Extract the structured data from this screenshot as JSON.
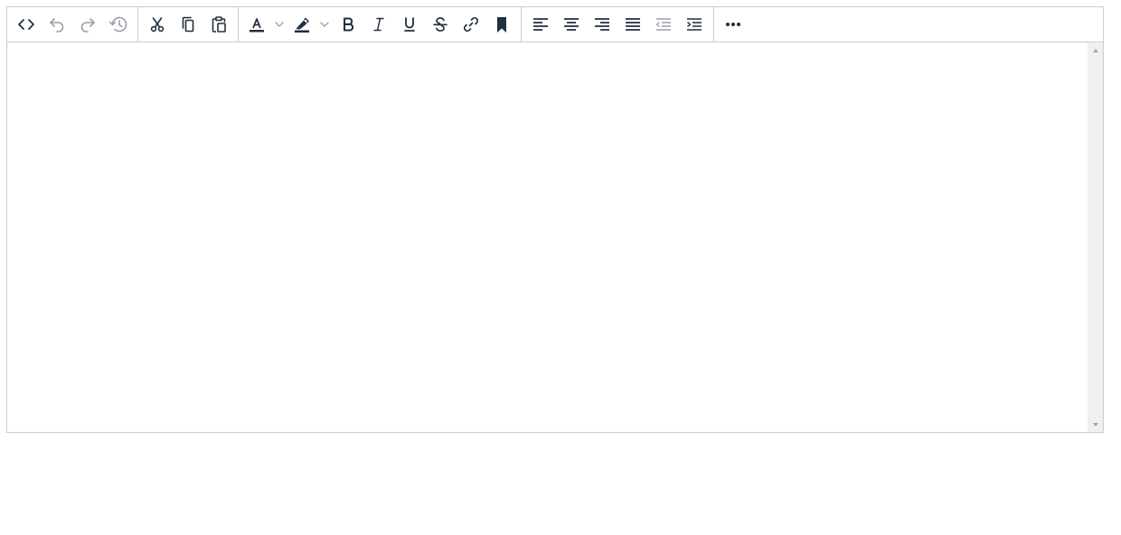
{
  "toolbar": {
    "groups": [
      [
        "source-code",
        "undo",
        "redo",
        "restore-draft"
      ],
      [
        "cut",
        "copy",
        "paste"
      ],
      [
        "text-color",
        "highlight-color",
        "bold",
        "italic",
        "underline",
        "strikethrough",
        "link",
        "bookmark"
      ],
      [
        "align-left",
        "align-center",
        "align-right",
        "justify",
        "outdent",
        "indent"
      ],
      [
        "more"
      ]
    ],
    "disabled": [
      "undo",
      "redo",
      "restore-draft",
      "outdent"
    ],
    "icon_color": "#222f3e",
    "text_color_swatch": "#222f3e",
    "highlight_color_swatch": "#222f3e"
  },
  "editor": {
    "content": ""
  },
  "colors": {
    "border": "#cccccc",
    "scrollbar_track": "#f0f0f0",
    "scrollbar_arrow": "#a3a3a3"
  }
}
